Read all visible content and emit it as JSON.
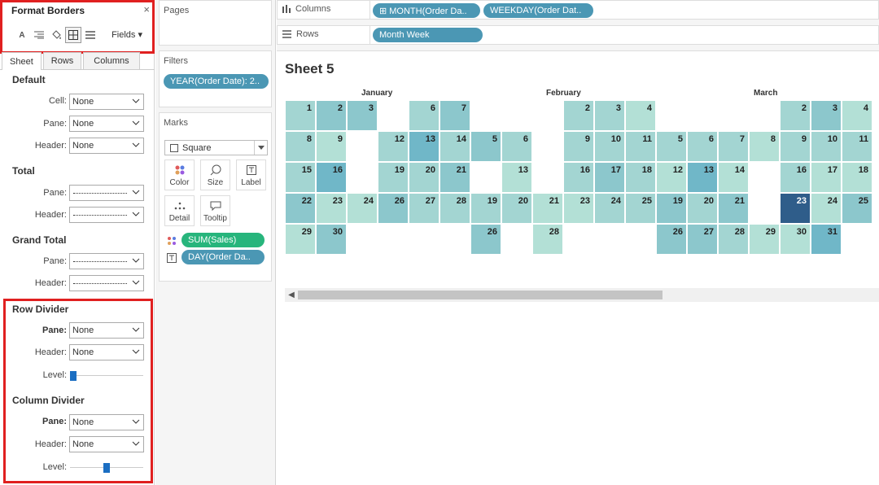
{
  "format": {
    "title": "Format Borders",
    "close": "×",
    "fields": "Fields ▾",
    "tools": [
      "font-icon",
      "align-icon",
      "shading-icon",
      "borders-icon",
      "lines-icon"
    ],
    "tabs": [
      "Sheet",
      "Rows",
      "Columns"
    ],
    "sections": {
      "default": {
        "title": "Default",
        "cell_label": "Cell:",
        "cell": "None",
        "pane_label": "Pane:",
        "pane": "None",
        "header_label": "Header:",
        "header": "None"
      },
      "total": {
        "title": "Total",
        "pane_label": "Pane:",
        "header_label": "Header:"
      },
      "grand_total": {
        "title": "Grand Total",
        "pane_label": "Pane:",
        "header_label": "Header:"
      },
      "row_divider": {
        "title": "Row Divider",
        "pane_label": "Pane:",
        "pane": "None",
        "header_label": "Header:",
        "header": "None",
        "level_label": "Level:",
        "level": 0
      },
      "column_divider": {
        "title": "Column Divider",
        "pane_label": "Pane:",
        "pane": "None",
        "header_label": "Header:",
        "header": "None",
        "level_label": "Level:",
        "level": 0.5
      }
    }
  },
  "cards": {
    "pages": "Pages",
    "filters": {
      "title": "Filters",
      "pills": [
        "YEAR(Order Date): 2.."
      ]
    },
    "marks": {
      "title": "Marks",
      "type": "Square",
      "buttons": [
        "Color",
        "Size",
        "Label",
        "Detail",
        "Tooltip"
      ],
      "pills": [
        {
          "label": "SUM(Sales)",
          "color": "green",
          "icon": "color-dots-icon"
        },
        {
          "label": "DAY(Order Da..",
          "color": "blue",
          "icon": "text-icon"
        }
      ]
    }
  },
  "shelves": {
    "columns_label": "Columns",
    "columns_pills": [
      "⊞ MONTH(Order Da..",
      "WEEKDAY(Order Dat.."
    ],
    "rows_label": "Rows",
    "rows_pills": [
      "Month Week"
    ]
  },
  "sheet": {
    "title": "Sheet 5",
    "months": [
      "January",
      "February",
      "March"
    ],
    "colors": {
      "c0": "#b3e0d6",
      "c1": "#a3d5d2",
      "c2": "#8cc7cc",
      "c3": "#70b7c8",
      "c4": "#2f5d8a"
    },
    "cells": [
      [
        "1",
        "c1"
      ],
      [
        "2",
        "c2"
      ],
      [
        "3",
        "c2"
      ],
      [
        "6",
        "c1"
      ],
      [
        "7",
        "c2"
      ],
      [
        "8",
        "c1"
      ],
      [
        "9",
        "c0"
      ],
      [
        "12",
        "c1"
      ],
      [
        "13",
        "c3"
      ],
      [
        "14",
        "c1"
      ],
      [
        "15",
        "c1"
      ],
      [
        "16",
        "c3"
      ],
      [
        "19",
        "c1"
      ],
      [
        "20",
        "c1"
      ],
      [
        "21",
        "c2"
      ],
      [
        "22",
        "c2"
      ],
      [
        "23",
        "c0"
      ],
      [
        "24",
        "c0"
      ],
      [
        "26",
        "c2"
      ],
      [
        "27",
        "c1"
      ],
      [
        "28",
        "c1"
      ],
      [
        "29",
        "c0"
      ],
      [
        "30",
        "c2"
      ],
      [
        "5",
        "c2"
      ],
      [
        "6",
        "c1"
      ],
      [
        "19",
        "c1"
      ],
      [
        "20",
        "c1"
      ],
      [
        "26",
        "c2"
      ],
      [
        "13",
        "c0"
      ],
      [
        "21",
        "c0"
      ],
      [
        "28",
        "c0"
      ],
      [
        "2",
        "c1"
      ],
      [
        "3",
        "c1"
      ],
      [
        "4",
        "c0"
      ],
      [
        "9",
        "c1"
      ],
      [
        "10",
        "c1"
      ],
      [
        "11",
        "c1"
      ],
      [
        "16",
        "c1"
      ],
      [
        "17",
        "c2"
      ],
      [
        "18",
        "c1"
      ],
      [
        "23",
        "c0"
      ],
      [
        "24",
        "c1"
      ],
      [
        "25",
        "c1"
      ],
      [
        "5",
        "c1"
      ],
      [
        "6",
        "c1"
      ],
      [
        "7",
        "c1"
      ],
      [
        "8",
        "c0"
      ],
      [
        "12",
        "c0"
      ],
      [
        "13",
        "c3"
      ],
      [
        "14",
        "c0"
      ],
      [
        "19",
        "c2"
      ],
      [
        "20",
        "c1"
      ],
      [
        "21",
        "c2"
      ],
      [
        "26",
        "c2"
      ],
      [
        "27",
        "c2"
      ],
      [
        "28",
        "c1"
      ],
      [
        "29",
        "c0"
      ],
      [
        "30",
        "c0"
      ],
      [
        "31",
        "c3"
      ],
      [
        "2",
        "c1"
      ],
      [
        "3",
        "c2"
      ],
      [
        "4",
        "c0"
      ],
      [
        "9",
        "c1"
      ],
      [
        "10",
        "c1"
      ],
      [
        "11",
        "c1"
      ],
      [
        "16",
        "c1"
      ],
      [
        "17",
        "c0"
      ],
      [
        "18",
        "c0"
      ],
      [
        "23",
        "c4"
      ],
      [
        "24",
        "c0"
      ],
      [
        "25",
        "c2"
      ]
    ]
  }
}
